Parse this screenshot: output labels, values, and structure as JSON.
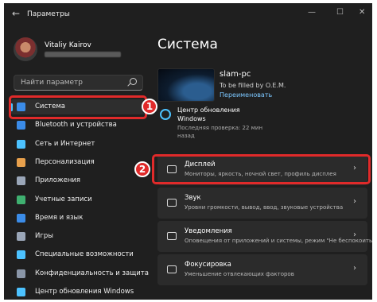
{
  "window": {
    "app_title": "Параметры",
    "back_glyph": "←",
    "minimize_glyph": "—",
    "maximize_glyph": "☐",
    "close_glyph": "✕"
  },
  "user": {
    "name": "Vitaliy Kairov"
  },
  "search": {
    "placeholder": "Найти параметр"
  },
  "sidebar": {
    "items": [
      {
        "label": "Система",
        "icon": "monitor-icon",
        "color": "#3b8ce8",
        "active": true
      },
      {
        "label": "Bluetooth и устройства",
        "icon": "bluetooth-icon",
        "color": "#3b8ce8"
      },
      {
        "label": "Сеть и Интернет",
        "icon": "wifi-icon",
        "color": "#4cc2ff"
      },
      {
        "label": "Персонализация",
        "icon": "brush-icon",
        "color": "#e8a04c"
      },
      {
        "label": "Приложения",
        "icon": "apps-icon",
        "color": "#9aa6b8"
      },
      {
        "label": "Учетные записи",
        "icon": "person-icon",
        "color": "#3fb070"
      },
      {
        "label": "Время и язык",
        "icon": "globe-clock-icon",
        "color": "#3b8ce8"
      },
      {
        "label": "Игры",
        "icon": "gamepad-icon",
        "color": "#9aa6b8"
      },
      {
        "label": "Специальные возможности",
        "icon": "accessibility-icon",
        "color": "#4cc2ff"
      },
      {
        "label": "Конфиденциальность и защита",
        "icon": "shield-icon",
        "color": "#8a96a8"
      },
      {
        "label": "Центр обновления Windows",
        "icon": "update-icon",
        "color": "#4cc2ff"
      }
    ]
  },
  "main": {
    "title": "Система",
    "device": {
      "name": "slam-pc",
      "model": "To be filled by O.E.M.",
      "rename": "Переименовать"
    },
    "update": {
      "title_line1": "Центр обновления",
      "title_line2": "Windows",
      "last_check_line1": "Последняя проверка: 22 мин",
      "last_check_line2": "назад"
    },
    "cards": [
      {
        "title": "Дисплей",
        "subtitle": "Мониторы, яркость, ночной свет, профиль дисплея",
        "icon": "display-icon"
      },
      {
        "title": "Звук",
        "subtitle": "Уровни громкости, вывод, ввод, звуковые устройства",
        "icon": "speaker-icon"
      },
      {
        "title": "Уведомления",
        "subtitle": "Оповещения от приложений и системы, режим \"Не беспокоить\"",
        "icon": "bell-icon"
      },
      {
        "title": "Фокусировка",
        "subtitle": "Уменьшение отвлекающих факторов",
        "icon": "focus-icon"
      }
    ]
  },
  "annotations": {
    "badge1": "1",
    "badge2": "2",
    "highlight_color": "#e02a2a"
  }
}
